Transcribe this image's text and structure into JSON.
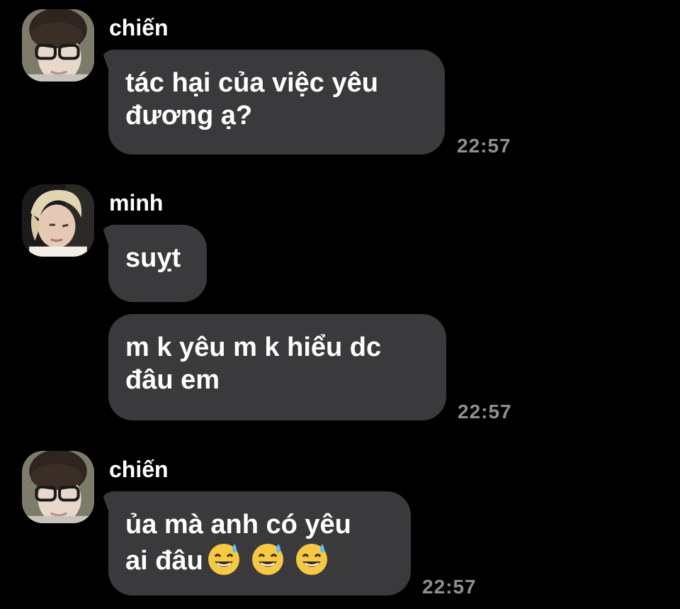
{
  "messages": [
    {
      "sender": "chiến",
      "lines": [
        "tác hại của việc yêu",
        "đương ạ?"
      ],
      "time": "22:57"
    },
    {
      "sender": "minh",
      "lines": [
        "suỵt"
      ]
    },
    {
      "lines": [
        "m k yêu m k hiểu dc",
        "đâu em"
      ],
      "time": "22:57"
    },
    {
      "sender": "chiến",
      "lines": [
        "ủa mà anh có yêu",
        "ai đâu"
      ],
      "emoji": [
        "grinning-sweat-emoji",
        "grinning-sweat-emoji",
        "grinning-sweat-emoji"
      ],
      "time": "22:57"
    }
  ],
  "colors": {
    "background": "#000000",
    "bubble": "#3a3a3c",
    "timestamp": "#8e8e93",
    "text": "#ffffff"
  }
}
